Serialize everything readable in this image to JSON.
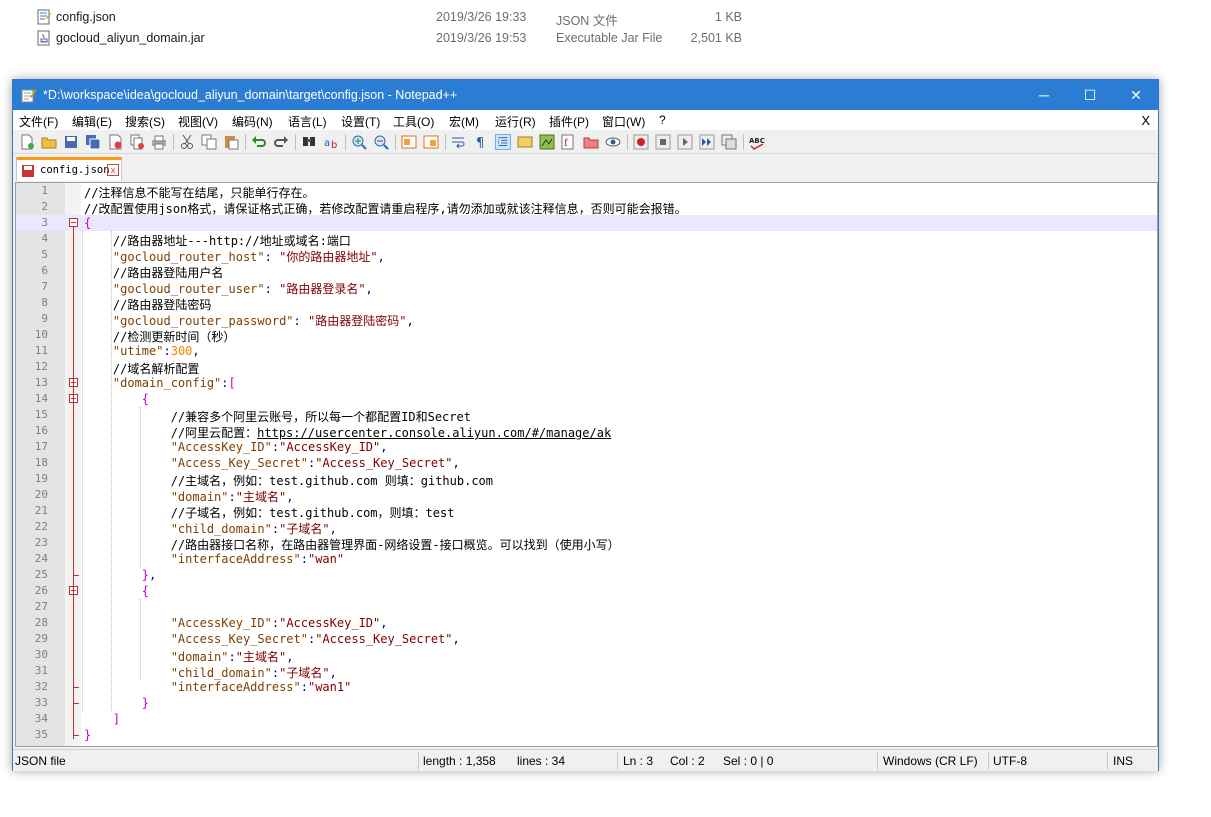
{
  "explorer": {
    "files": [
      {
        "name": "config.json",
        "date": "2019/3/26 19:33",
        "type": "JSON 文件",
        "size": "1 KB",
        "icon": "json-file-icon"
      },
      {
        "name": "gocloud_aliyun_domain.jar",
        "date": "2019/3/26 19:53",
        "type": "Executable Jar File",
        "size": "2,501 KB",
        "icon": "jar-file-icon"
      }
    ]
  },
  "window": {
    "title": "*D:\\workspace\\idea\\gocloud_aliyun_domain\\target\\config.json - Notepad++",
    "minimize": "─",
    "maximize": "☐",
    "close": "✕"
  },
  "menu": {
    "items": [
      "文件(F)",
      "编辑(E)",
      "搜索(S)",
      "视图(V)",
      "编码(N)",
      "语言(L)",
      "设置(T)",
      "工具(O)",
      "宏(M)",
      "运行(R)",
      "插件(P)",
      "窗口(W)",
      "?"
    ],
    "close": "X"
  },
  "tab": {
    "label": "config.json",
    "close": "x"
  },
  "editor": {
    "current_line": 3,
    "lines": [
      "//注释信息不能写在结尾，只能单行存在。",
      "//改配置使用json格式，请保证格式正确，若修改配置请重启程序,请勿添加或就该注释信息，否则可能会报错。",
      "{",
      "    //路由器地址---http://地址或域名:端口",
      "    \"gocloud_router_host\": \"你的路由器地址\",",
      "    //路由器登陆用户名",
      "    \"gocloud_router_user\": \"路由器登录名\",",
      "    //路由器登陆密码",
      "    \"gocloud_router_password\": \"路由器登陆密码\",",
      "    //检测更新时间（秒）",
      "    \"utime\":300,",
      "    //域名解析配置",
      "    \"domain_config\":[",
      "        {",
      "            //兼容多个阿里云账号，所以每一个都配置ID和Secret",
      "            //阿里云配置：https://usercenter.console.aliyun.com/#/manage/ak",
      "            \"AccessKey_ID\":\"AccessKey_ID\",",
      "            \"Access_Key_Secret\":\"Access_Key_Secret\",",
      "            //主域名，例如：test.github.com 则填：github.com",
      "            \"domain\":\"主域名\",",
      "            //子域名，例如：test.github.com，则填：test",
      "            \"child_domain\":\"子域名\",",
      "            //路由器接口名称，在路由器管理界面-网络设置-接口概览。可以找到（使用小写）",
      "            \"interfaceAddress\":\"wan\"",
      "        },",
      "        {",
      "",
      "            \"AccessKey_ID\":\"AccessKey_ID\",",
      "            \"Access_Key_Secret\":\"Access_Key_Secret\",",
      "            \"domain\":\"主域名\",",
      "            \"child_domain\":\"子域名\",",
      "            \"interfaceAddress\":\"wan1\"",
      "        }",
      "    ]",
      "}"
    ]
  },
  "status": {
    "filetype": "JSON file",
    "length": "length : 1,358",
    "lines": "lines : 34",
    "ln": "Ln : 3",
    "col": "Col : 2",
    "sel": "Sel : 0 | 0",
    "eol": "Windows (CR LF)",
    "encoding": "UTF-8",
    "mode": "INS"
  }
}
